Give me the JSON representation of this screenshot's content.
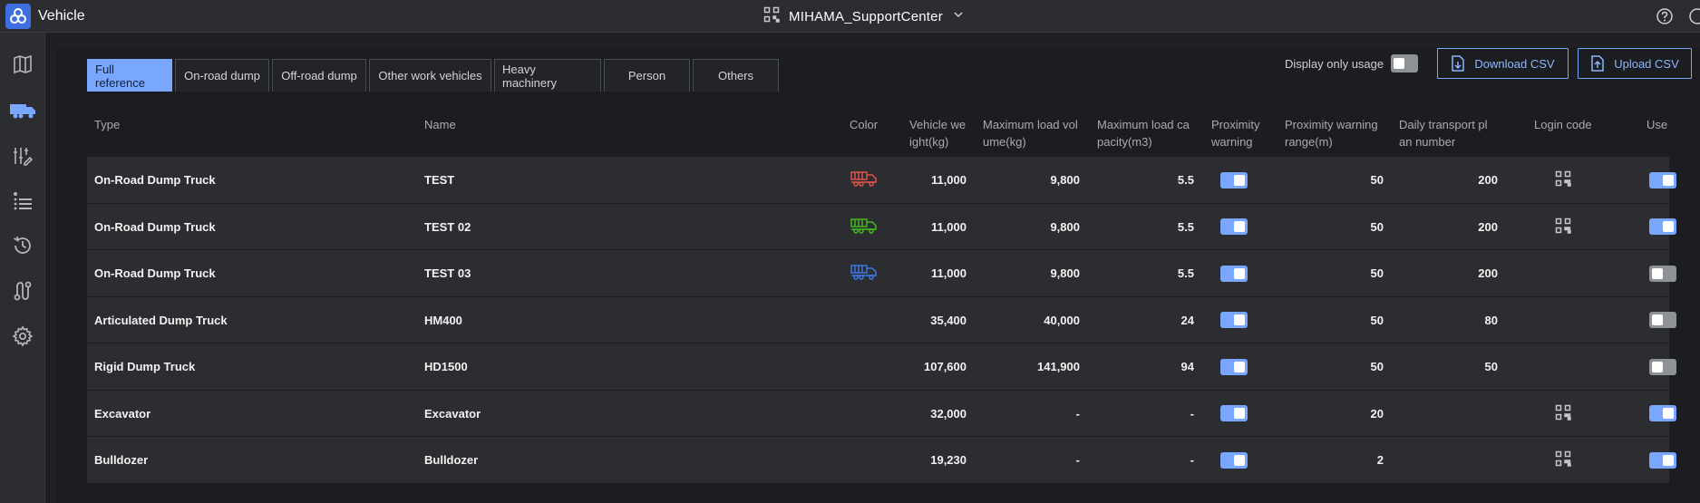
{
  "app": {
    "title": "Vehicle",
    "site_name": "MIHAMA_SupportCenter"
  },
  "sidebar": {
    "items": [
      {
        "icon": "map-icon"
      },
      {
        "icon": "truck-icon",
        "active": true
      },
      {
        "icon": "filter-edit-icon"
      },
      {
        "icon": "list-icon"
      },
      {
        "icon": "history-icon"
      },
      {
        "icon": "route-icon"
      },
      {
        "icon": "gear-icon"
      }
    ]
  },
  "tabs": [
    {
      "label": "Full reference",
      "active": true
    },
    {
      "label": "On-road dump"
    },
    {
      "label": "Off-road dump"
    },
    {
      "label": "Other work vehicles"
    },
    {
      "label": "Heavy machinery"
    },
    {
      "label": "Person"
    },
    {
      "label": "Others"
    }
  ],
  "toolbar": {
    "display_only_usage_label": "Display only usage",
    "display_only_usage_on": false,
    "download_csv_label": "Download CSV",
    "upload_csv_label": "Upload CSV"
  },
  "table": {
    "headers": {
      "type": "Type",
      "name": "Name",
      "color": "Color",
      "weight_1": "Vehicle we",
      "weight_2": "ight(kg)",
      "volume_1": "Maximum load vol",
      "volume_2": "ume(kg)",
      "capacity_1": "Maximum load ca",
      "capacity_2": "pacity(m3)",
      "proximity_1": "Proximity",
      "proximity_2": "warning",
      "range_1": "Proximity warning",
      "range_2": "range(m)",
      "plan_1": "Daily transport pl",
      "plan_2": "an number",
      "login": "Login code",
      "use": "Use"
    },
    "rows": [
      {
        "type": "On-Road Dump Truck",
        "name": "TEST",
        "truck_color": "#e0524a",
        "weight": "11,000",
        "volume": "9,800",
        "capacity": "5.5",
        "proximity": true,
        "range": "50",
        "plan": "200",
        "qr": true,
        "use": true
      },
      {
        "type": "On-Road Dump Truck",
        "name": "TEST 02",
        "truck_color": "#46b61e",
        "weight": "11,000",
        "volume": "9,800",
        "capacity": "5.5",
        "proximity": true,
        "range": "50",
        "plan": "200",
        "qr": true,
        "use": true
      },
      {
        "type": "On-Road Dump Truck",
        "name": "TEST 03",
        "truck_color": "#3a78e6",
        "weight": "11,000",
        "volume": "9,800",
        "capacity": "5.5",
        "proximity": true,
        "range": "50",
        "plan": "200",
        "qr": false,
        "use": false
      },
      {
        "type": "Articulated Dump Truck",
        "name": "HM400",
        "truck_color": "",
        "weight": "35,400",
        "volume": "40,000",
        "capacity": "24",
        "proximity": true,
        "range": "50",
        "plan": "80",
        "qr": false,
        "use": false
      },
      {
        "type": "Rigid Dump Truck",
        "name": "HD1500",
        "truck_color": "",
        "weight": "107,600",
        "volume": "141,900",
        "capacity": "94",
        "proximity": true,
        "range": "50",
        "plan": "50",
        "qr": false,
        "use": false
      },
      {
        "type": "Excavator",
        "name": "Excavator",
        "truck_color": "",
        "weight": "32,000",
        "volume": "-",
        "capacity": "-",
        "proximity": true,
        "range": "20",
        "plan": "",
        "qr": true,
        "use": true
      },
      {
        "type": "Bulldozer",
        "name": "Bulldozer",
        "truck_color": "",
        "weight": "19,230",
        "volume": "-",
        "capacity": "-",
        "proximity": true,
        "range": "2",
        "plan": "",
        "qr": true,
        "use": true
      }
    ]
  },
  "colors": {
    "accent": "#79a7ff",
    "row_bg": "#2b2d31",
    "page_bg": "#1b1d20"
  }
}
